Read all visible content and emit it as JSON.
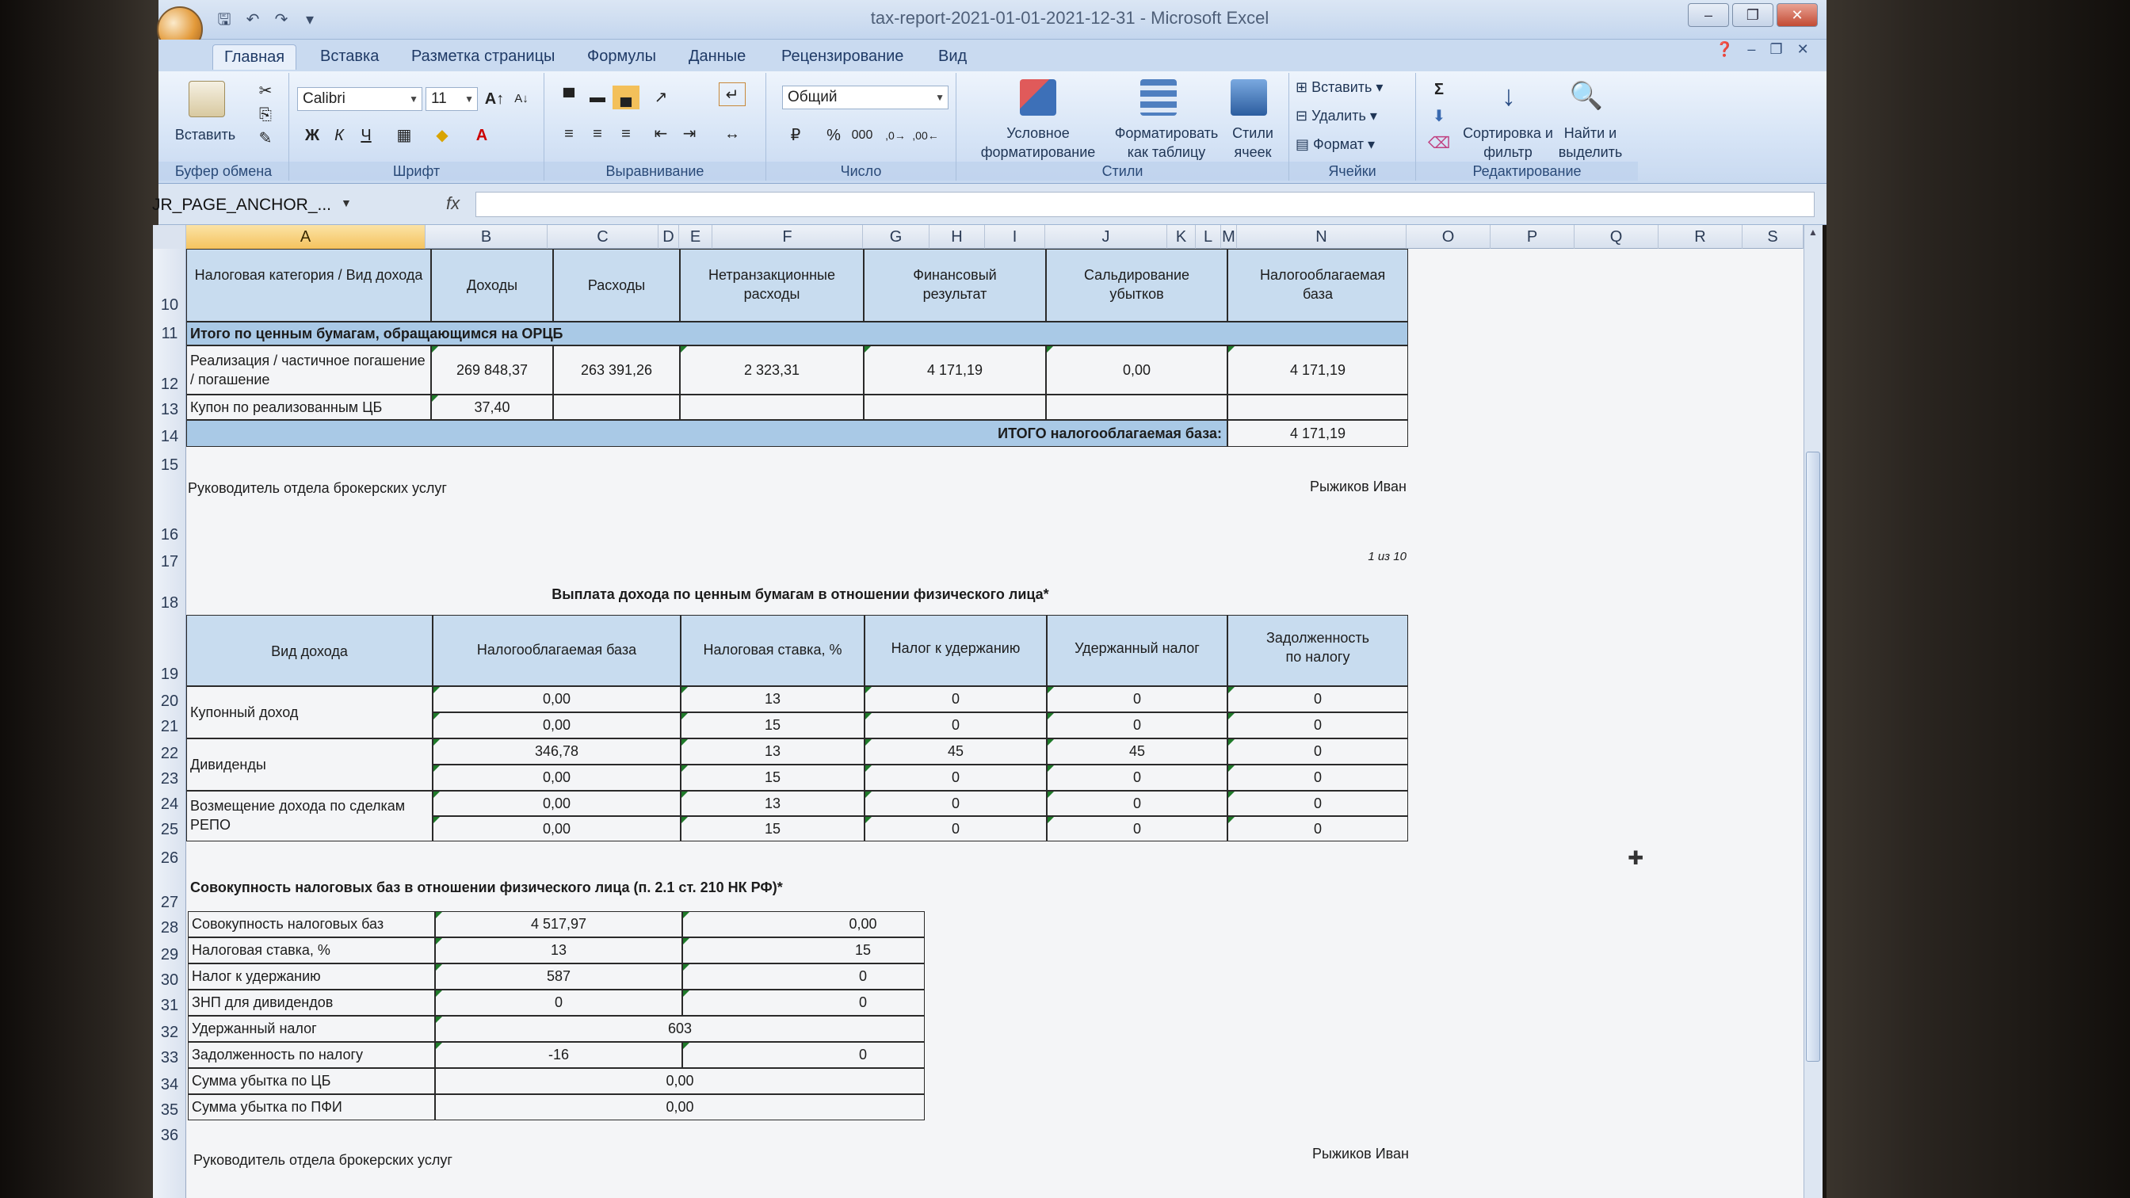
{
  "window": {
    "title": "tax-report-2021-01-01-2021-12-31 - Microsoft Excel"
  },
  "ribbon": {
    "tabs": [
      "Главная",
      "Вставка",
      "Разметка страницы",
      "Формулы",
      "Данные",
      "Рецензирование",
      "Вид"
    ],
    "clipboard": {
      "paste_label": "Вставить",
      "group_label": "Буфер обмена"
    },
    "font": {
      "name": "Calibri",
      "size": "11",
      "group_label": "Шрифт"
    },
    "alignment": {
      "group_label": "Выравнивание"
    },
    "number": {
      "format": "Общий",
      "group_label": "Число"
    },
    "styles": {
      "conditional": "Условное форматирование",
      "as_table": "Форматировать как таблицу",
      "cell_styles": "Стили ячеек",
      "group_label": "Стили"
    },
    "cells": {
      "insert": "Вставить",
      "delete": "Удалить",
      "format": "Формат",
      "group_label": "Ячейки"
    },
    "editing": {
      "sort": "Сортировка и фильтр",
      "find": "Найти и выделить",
      "group_label": "Редактирование"
    }
  },
  "formula_bar": {
    "name_box": "JR_PAGE_ANCHOR_...",
    "fx": "fx",
    "value": ""
  },
  "columns": [
    "A",
    "B",
    "C",
    "D",
    "E",
    "F",
    "G",
    "H",
    "I",
    "J",
    "K",
    "L",
    "M",
    "N",
    "O",
    "P",
    "Q",
    "R",
    "S"
  ],
  "rows": [
    "10",
    "11",
    "12",
    "13",
    "14",
    "15",
    "16",
    "17",
    "18",
    "19",
    "20",
    "21",
    "22",
    "23",
    "24",
    "25",
    "26",
    "27",
    "28",
    "29",
    "30",
    "31",
    "32",
    "33",
    "34",
    "35",
    "36"
  ],
  "table1": {
    "headers": [
      "Налоговая категория / Вид дохода",
      "Доходы",
      "Расходы",
      "Нетранзакционные расходы",
      "Финансовый результат",
      "Сальдирование убытков",
      "Налогооблагаемая база"
    ],
    "section": "Итого по ценным бумагам, обращающимся на ОРЦБ",
    "row_sale": {
      "label": "Реализация / частичное погашение / погашение",
      "income": "269 848,37",
      "expense": "263 391,26",
      "nontrans": "2 323,31",
      "result": "4 171,19",
      "saldo": "0,00",
      "base": "4 171,19"
    },
    "row_coupon": {
      "label": "Купон по реализованным ЦБ",
      "income": "37,40"
    },
    "total_label": "ИТОГО налогооблагаемая база:",
    "total_value": "4 171,19"
  },
  "signature1": {
    "position": "Руководитель отдела брокерских услуг",
    "name": "Рыжиков Иван"
  },
  "page_counter": "1 из 10",
  "table2": {
    "title": "Выплата дохода по ценным бумагам в отношении физического лица*",
    "headers": [
      "Вид дохода",
      "Налогооблагаемая база",
      "Налоговая ставка, %",
      "Налог к удержанию",
      "Удержанный налог",
      "Задолженность по налогу"
    ],
    "groups": [
      "Купонный доход",
      "Дивиденды",
      "Возмещение дохода по сделкам РЕПО"
    ],
    "rows": [
      [
        "0,00",
        "13",
        "0",
        "0",
        "0"
      ],
      [
        "0,00",
        "15",
        "0",
        "0",
        "0"
      ],
      [
        "346,78",
        "13",
        "45",
        "45",
        "0"
      ],
      [
        "0,00",
        "15",
        "0",
        "0",
        "0"
      ],
      [
        "0,00",
        "13",
        "0",
        "0",
        "0"
      ],
      [
        "0,00",
        "15",
        "0",
        "0",
        "0"
      ]
    ]
  },
  "table3": {
    "title": "Совокупность налоговых баз в отношении физического лица (п. 2.1 ст. 210 НК РФ)*",
    "rows": [
      {
        "label": "Совокупность налоговых баз",
        "v13": "4 517,97",
        "v15": "0,00"
      },
      {
        "label": "Налоговая ставка, %",
        "v13": "13",
        "v15": "15"
      },
      {
        "label": "Налог к удержанию",
        "v13": "587",
        "v15": "0"
      },
      {
        "label": "ЗНП для дивидендов",
        "v13": "0",
        "v15": "0"
      }
    ],
    "withheld": {
      "label": "Удержанный налог",
      "value": "603"
    },
    "debt": {
      "label": "Задолженность по налогу",
      "v13": "-16",
      "v15": "0"
    },
    "loss_cb": {
      "label": "Сумма убытка по ЦБ",
      "value": "0,00"
    },
    "loss_pfi": {
      "label": "Сумма убытка по ПФИ",
      "value": "0,00"
    }
  },
  "signature2": {
    "position": "Руководитель отдела брокерских услуг",
    "name": "Рыжиков Иван"
  }
}
